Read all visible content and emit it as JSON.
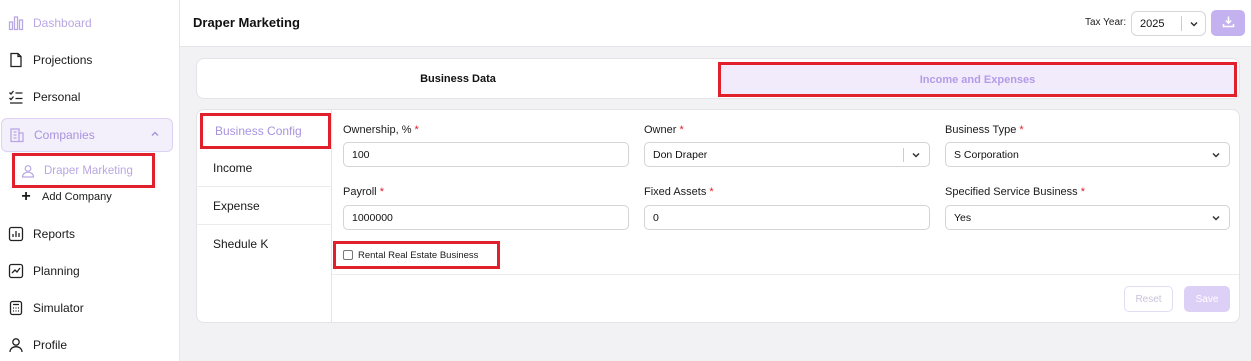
{
  "sidebar": {
    "items": [
      {
        "label": "Dashboard",
        "icon": "bar-chart-icon"
      },
      {
        "label": "Projections",
        "icon": "document-icon"
      },
      {
        "label": "Personal",
        "icon": "checklist-icon"
      },
      {
        "label": "Companies",
        "icon": "building-icon"
      },
      {
        "label": "Reports",
        "icon": "report-icon"
      },
      {
        "label": "Planning",
        "icon": "planning-icon"
      },
      {
        "label": "Simulator",
        "icon": "calculator-icon"
      },
      {
        "label": "Profile",
        "icon": "user-icon"
      }
    ],
    "companies_sub": [
      {
        "label": "Draper Marketing",
        "icon": "user-icon"
      },
      {
        "label": "Add Company",
        "icon": "plus-icon"
      }
    ]
  },
  "header": {
    "title": "Draper Marketing",
    "tax_year_label": "Tax Year:",
    "tax_year_value": "2025"
  },
  "tabs": [
    {
      "label": "Business Data"
    },
    {
      "label": "Income and Expenses"
    }
  ],
  "subnav": [
    {
      "label": "Business Config"
    },
    {
      "label": "Income"
    },
    {
      "label": "Expense"
    },
    {
      "label": "Shedule K"
    }
  ],
  "form": {
    "ownership": {
      "label": "Ownership, %",
      "value": "100"
    },
    "owner": {
      "label": "Owner",
      "value": "Don Draper"
    },
    "business_type": {
      "label": "Business Type",
      "value": "S Corporation"
    },
    "payroll": {
      "label": "Payroll",
      "value": "1000000"
    },
    "fixed_assets": {
      "label": "Fixed Assets",
      "value": "0"
    },
    "specified_service": {
      "label": "Specified Service Business",
      "value": "Yes"
    },
    "rental_checkbox": {
      "label": "Rental Real Estate Business",
      "checked": false
    },
    "required_mark": "*"
  },
  "actions": {
    "reset": "Reset",
    "save": "Save"
  },
  "colors": {
    "accent": "#a993de",
    "highlight_border": "#e0202a",
    "required": "#e0202a"
  }
}
